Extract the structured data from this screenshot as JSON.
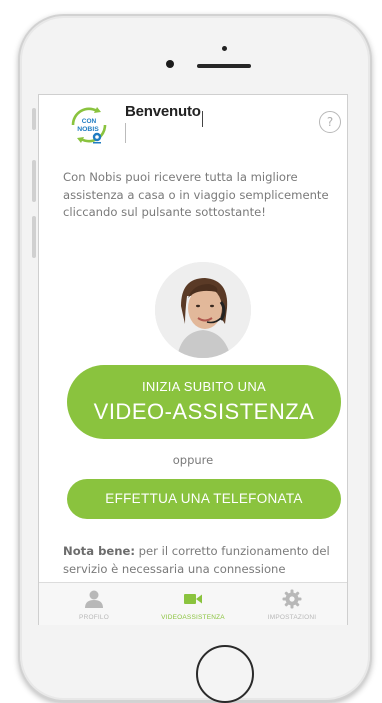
{
  "header": {
    "logo_text_top": "CON",
    "logo_text_bottom": "NOBIS",
    "title": "Benvenuto",
    "help_glyph": "?"
  },
  "intro": "Con Nobis puoi ricevere tutta la migliore assistenza a casa o in viaggio semplicemente cliccando sul pulsante sottostante!",
  "video_button": {
    "line1": "INIZIA SUBITO UNA",
    "line2": "VIDEO-ASSISTENZA"
  },
  "or_text": "oppure",
  "phone_button": {
    "label": "EFFETTUA UNA TELEFONATA"
  },
  "note": {
    "bold": "Nota bene:",
    "text": " per il corretto funzionamento del servizio è necessaria una connessione"
  },
  "tabs": [
    {
      "label": "PROFILO",
      "icon": "user-icon",
      "active": false
    },
    {
      "label": "VIDEOASSISTENZA",
      "icon": "video-camera-icon",
      "active": true
    },
    {
      "label": "IMPOSTAZIONI",
      "icon": "gear-icon",
      "active": false
    }
  ],
  "colors": {
    "accent": "#8ac33e",
    "logo_blue": "#1f7cc1",
    "text": "#7a7a7a"
  }
}
